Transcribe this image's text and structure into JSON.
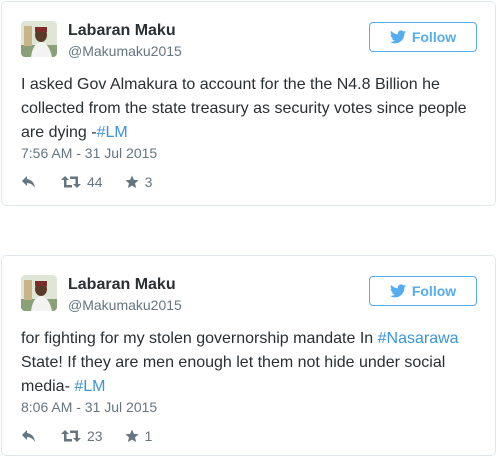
{
  "tweets": [
    {
      "name": "Labaran Maku",
      "handle": "@Makumaku2015",
      "follow_label": "Follow",
      "text_plain": "I asked Gov Almakura to account for the the N4.8 Billion he collected from the state treasury as security votes since people are dying -",
      "hashtag_1": "#LM",
      "timestamp": "7:56 AM - 31 Jul 2015",
      "retweets": "44",
      "favorites": "3"
    },
    {
      "name": "Labaran Maku",
      "handle": "@Makumaku2015",
      "follow_label": "Follow",
      "text_part_1": "for fighting for my stolen governorship mandate In ",
      "hashtag_1": "#Nasarawa",
      "text_part_2": " State! If they are men enough let them not hide under social media- ",
      "hashtag_2": "#LM",
      "timestamp": "8:06 AM - 31 Jul 2015",
      "retweets": "23",
      "favorites": "1"
    }
  ],
  "colors": {
    "accent": "#55acee",
    "link": "#3b94d9",
    "meta": "#66757f",
    "border": "#e1e8ed"
  },
  "icons": [
    "twitter-bird-icon",
    "reply-icon",
    "retweet-icon",
    "star-icon"
  ]
}
